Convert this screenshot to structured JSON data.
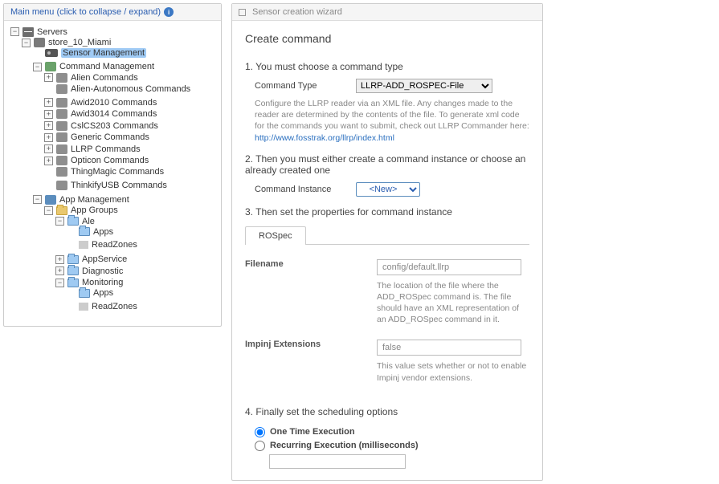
{
  "sidebar": {
    "title": "Main menu (click to collapse / expand)",
    "root": {
      "label": "Servers",
      "children": [
        {
          "label": "store_10_Miami",
          "children_labels": {
            "sensor_mgmt": "Sensor Management",
            "cmd_mgmt": "Command Management",
            "cmds": [
              "Alien Commands",
              "Alien-Autonomous Commands",
              "Awid2010 Commands",
              "Awid3014 Commands",
              "CslCS203 Commands",
              "Generic Commands",
              "LLRP Commands",
              "Opticon Commands",
              "ThingMagic Commands",
              "ThinkifyUSB Commands"
            ],
            "app_mgmt": "App Management",
            "app_groups": "App Groups",
            "ale": "Ale",
            "ale_apps": "Apps",
            "ale_rz": "ReadZones",
            "appservice": "AppService",
            "diag": "Diagnostic",
            "mon": "Monitoring",
            "mon_apps": "Apps",
            "mon_rz": "ReadZones"
          }
        }
      ]
    }
  },
  "wizard": {
    "header": "Sensor creation wizard",
    "title": "Create command",
    "step1": "1. You must choose a command type",
    "command_type_label": "Command Type",
    "command_type_value": "LLRP-ADD_ROSPEC-File",
    "command_type_help_a": "Configure the LLRP reader via an XML file. Any changes made to the reader are determined by the contents of the file. To generate xml code for the commands you want to submit, check out LLRP Commander here: ",
    "command_type_help_link": "http://www.fosstrak.org/llrp/index.html",
    "step2": "2. Then you must either create a command instance or choose an already created one",
    "command_instance_label": "Command Instance",
    "command_instance_value": "<New>",
    "step3": "3. Then set the properties for command instance",
    "tab_label": "ROSpec",
    "prop_filename_label": "Filename",
    "prop_filename_value": "config/default.llrp",
    "prop_filename_desc": "The location of the file where the ADD_ROSpec command is. The file should have an XML representation of an ADD_ROSpec command in it.",
    "prop_impinj_label": "Impinj Extensions",
    "prop_impinj_value": "false",
    "prop_impinj_desc": "This value sets whether or not to enable Impinj vendor extensions.",
    "step4": "4. Finally set the scheduling options",
    "sched_one": "One Time Execution",
    "sched_rec": "Recurring Execution (milliseconds)"
  }
}
